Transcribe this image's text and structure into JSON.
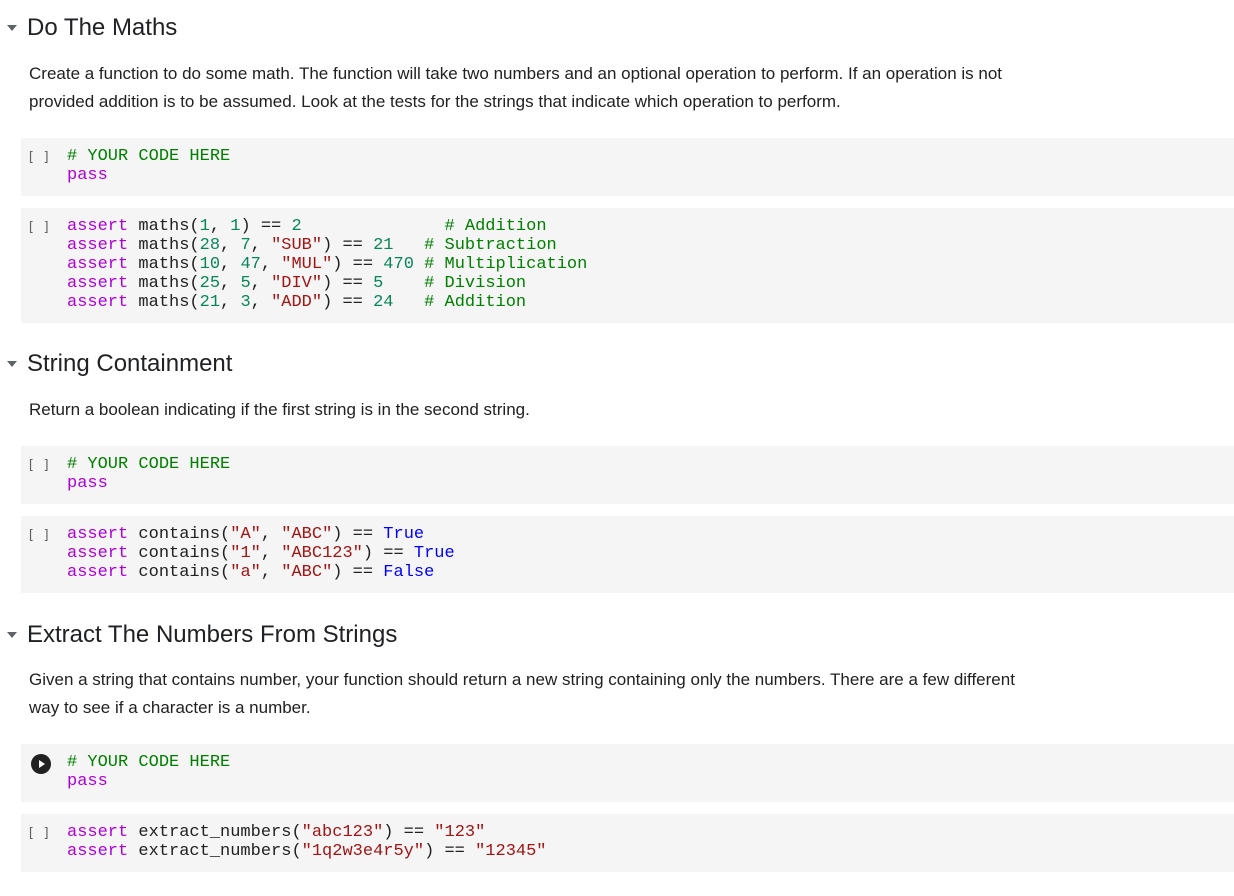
{
  "sections": [
    {
      "heading": "Do The Maths",
      "paragraph": "Create a function to do some math. The function will take two numbers and an optional operation to perform. If an operation is not provided addition is to be assumed. Look at the tests for the strings that indicate which operation to perform.",
      "cells": [
        {
          "prompt": "[ ]",
          "lines": [
            [
              {
                "t": "# YOUR CODE HERE",
                "c": "cm"
              }
            ],
            [
              {
                "t": "pass",
                "c": "kw"
              }
            ]
          ]
        },
        {
          "prompt": "[ ]",
          "lines": [
            [
              {
                "t": "assert",
                "c": "kw"
              },
              {
                "t": " maths("
              },
              {
                "t": "1",
                "c": "nm"
              },
              {
                "t": ", "
              },
              {
                "t": "1",
                "c": "nm"
              },
              {
                "t": ") == "
              },
              {
                "t": "2",
                "c": "nm"
              },
              {
                "t": "              "
              },
              {
                "t": "# Addition",
                "c": "cm"
              }
            ],
            [
              {
                "t": "assert",
                "c": "kw"
              },
              {
                "t": " maths("
              },
              {
                "t": "28",
                "c": "nm"
              },
              {
                "t": ", "
              },
              {
                "t": "7",
                "c": "nm"
              },
              {
                "t": ", "
              },
              {
                "t": "\"SUB\"",
                "c": "st"
              },
              {
                "t": ") == "
              },
              {
                "t": "21",
                "c": "nm"
              },
              {
                "t": "   "
              },
              {
                "t": "# Subtraction",
                "c": "cm"
              }
            ],
            [
              {
                "t": "assert",
                "c": "kw"
              },
              {
                "t": " maths("
              },
              {
                "t": "10",
                "c": "nm"
              },
              {
                "t": ", "
              },
              {
                "t": "47",
                "c": "nm"
              },
              {
                "t": ", "
              },
              {
                "t": "\"MUL\"",
                "c": "st"
              },
              {
                "t": ") == "
              },
              {
                "t": "470",
                "c": "nm"
              },
              {
                "t": " "
              },
              {
                "t": "# Multiplication",
                "c": "cm"
              }
            ],
            [
              {
                "t": "assert",
                "c": "kw"
              },
              {
                "t": " maths("
              },
              {
                "t": "25",
                "c": "nm"
              },
              {
                "t": ", "
              },
              {
                "t": "5",
                "c": "nm"
              },
              {
                "t": ", "
              },
              {
                "t": "\"DIV\"",
                "c": "st"
              },
              {
                "t": ") == "
              },
              {
                "t": "5",
                "c": "nm"
              },
              {
                "t": "    "
              },
              {
                "t": "# Division",
                "c": "cm"
              }
            ],
            [
              {
                "t": "assert",
                "c": "kw"
              },
              {
                "t": " maths("
              },
              {
                "t": "21",
                "c": "nm"
              },
              {
                "t": ", "
              },
              {
                "t": "3",
                "c": "nm"
              },
              {
                "t": ", "
              },
              {
                "t": "\"ADD\"",
                "c": "st"
              },
              {
                "t": ") == "
              },
              {
                "t": "24",
                "c": "nm"
              },
              {
                "t": "   "
              },
              {
                "t": "# Addition",
                "c": "cm"
              }
            ]
          ]
        }
      ]
    },
    {
      "heading": "String Containment",
      "paragraph": "Return a boolean indicating if the first string is in the second string.",
      "cells": [
        {
          "prompt": "[ ]",
          "lines": [
            [
              {
                "t": "# YOUR CODE HERE",
                "c": "cm"
              }
            ],
            [
              {
                "t": "pass",
                "c": "kw"
              }
            ]
          ]
        },
        {
          "prompt": "[ ]",
          "lines": [
            [
              {
                "t": "assert",
                "c": "kw"
              },
              {
                "t": " contains("
              },
              {
                "t": "\"A\"",
                "c": "st"
              },
              {
                "t": ", "
              },
              {
                "t": "\"ABC\"",
                "c": "st"
              },
              {
                "t": ") == "
              },
              {
                "t": "True",
                "c": "bl"
              }
            ],
            [
              {
                "t": "assert",
                "c": "kw"
              },
              {
                "t": " contains("
              },
              {
                "t": "\"1\"",
                "c": "st"
              },
              {
                "t": ", "
              },
              {
                "t": "\"ABC123\"",
                "c": "st"
              },
              {
                "t": ") == "
              },
              {
                "t": "True",
                "c": "bl"
              }
            ],
            [
              {
                "t": "assert",
                "c": "kw"
              },
              {
                "t": " contains("
              },
              {
                "t": "\"a\"",
                "c": "st"
              },
              {
                "t": ", "
              },
              {
                "t": "\"ABC\"",
                "c": "st"
              },
              {
                "t": ") == "
              },
              {
                "t": "False",
                "c": "bl"
              }
            ]
          ]
        }
      ]
    },
    {
      "heading": "Extract The Numbers From Strings",
      "paragraph": "Given a string that contains number, your function should return a new string containing only the numbers. There are a few different way to see if a character is a number.",
      "cells": [
        {
          "prompt": "run",
          "lines": [
            [
              {
                "t": "# YOUR CODE HERE",
                "c": "cm"
              }
            ],
            [
              {
                "t": "pass",
                "c": "kw"
              }
            ]
          ]
        },
        {
          "prompt": "[ ]",
          "lines": [
            [
              {
                "t": "assert",
                "c": "kw"
              },
              {
                "t": " extract_numbers("
              },
              {
                "t": "\"abc123\"",
                "c": "st"
              },
              {
                "t": ") == "
              },
              {
                "t": "\"123\"",
                "c": "st"
              }
            ],
            [
              {
                "t": "assert",
                "c": "kw"
              },
              {
                "t": " extract_numbers("
              },
              {
                "t": "\"1q2w3e4r5y\"",
                "c": "st"
              },
              {
                "t": ") == "
              },
              {
                "t": "\"12345\"",
                "c": "st"
              }
            ]
          ]
        }
      ]
    }
  ]
}
